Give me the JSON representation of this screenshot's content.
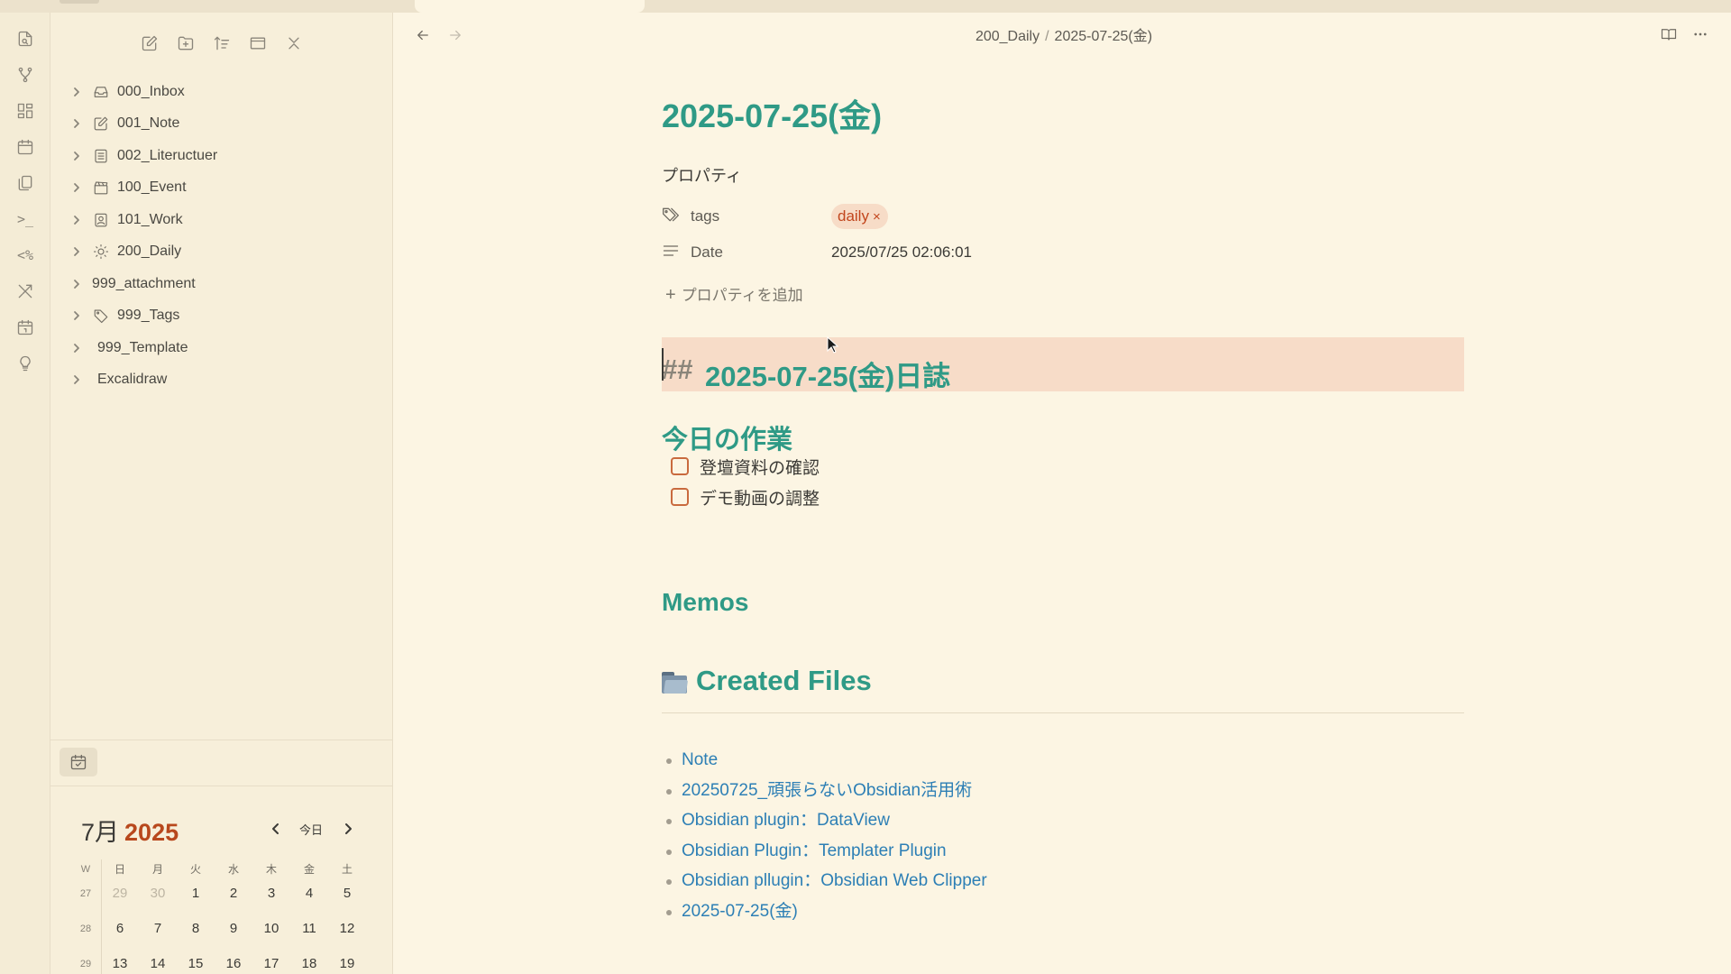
{
  "ribbon": {
    "icons": [
      "open-quick-switcher-icon",
      "graph-view-icon",
      "canvas-icon",
      "daily-note-icon",
      "templates-icon",
      "command-palette-icon",
      "templater-icon",
      "excalidraw-icon",
      "calendar-icon",
      "lightbulb-icon"
    ]
  },
  "explorer": {
    "toolbar": [
      "new-note-icon",
      "new-folder-icon",
      "sort-icon",
      "collapse-view-icon",
      "collapse-all-icon"
    ],
    "items": [
      {
        "label": "000_Inbox",
        "icon": "inbox-icon"
      },
      {
        "label": "001_Note",
        "icon": "edit-icon"
      },
      {
        "label": "002_Liteructuer",
        "icon": "list-icon"
      },
      {
        "label": "100_Event",
        "icon": "clapperboard-icon"
      },
      {
        "label": "101_Work",
        "icon": "contact-icon"
      },
      {
        "label": "200_Daily",
        "icon": "sun-icon"
      },
      {
        "label": "999_attachment",
        "icon": ""
      },
      {
        "label": "999_Tags",
        "icon": "tag-icon"
      },
      {
        "label": "999_Template",
        "icon": ""
      },
      {
        "label": "Excalidraw",
        "icon": ""
      }
    ]
  },
  "calendar": {
    "month": "7月",
    "year": "2025",
    "today_label": "今日",
    "headers": [
      "W",
      "日",
      "月",
      "火",
      "水",
      "木",
      "金",
      "土"
    ],
    "rows": [
      [
        "27",
        "29",
        "30",
        "1",
        "2",
        "3",
        "4",
        "5"
      ],
      [
        "28",
        "6",
        "7",
        "8",
        "9",
        "10",
        "11",
        "12"
      ],
      [
        "29",
        "13",
        "14",
        "15",
        "16",
        "17",
        "18",
        "19"
      ]
    ],
    "dim_cells": [
      "0-1",
      "0-2"
    ]
  },
  "header": {
    "breadcrumb_folder": "200_Daily",
    "breadcrumb_sep": "/",
    "breadcrumb_file": "2025-07-25(金)"
  },
  "note": {
    "title": "2025-07-25(金)",
    "properties_label": "プロパティ",
    "props": {
      "tags_name": "tags",
      "tag_value": "daily",
      "tag_remove": "×",
      "date_name": "Date",
      "date_value": "2025/07/25 02:06:01"
    },
    "add_property": "プロパティを追加",
    "heading_mark": "##",
    "heading_text": "2025-07-25(金)日誌",
    "tasks_heading": "今日の作業",
    "tasks": [
      "登壇資料の確認",
      "デモ動画の調整"
    ],
    "memos_heading": "Memos",
    "created_heading": "Created Files",
    "created_files": [
      "Note",
      "20250725_頑張らないObsidian活用術",
      "Obsidian plugin：DataView",
      "Obsidian Plugin：Templater Plugin",
      "Obsidian pllugin：Obsidian Web Clipper",
      "2025-07-25(金)"
    ]
  },
  "colors": {
    "background": "#fcf5e3",
    "heading": "#2f9a86",
    "link": "#2d7fb5",
    "tag_text": "#c2461d",
    "tag_bg": "#f7dcc7",
    "checkbox": "#c96a3e",
    "year_accent": "#b8481d"
  }
}
